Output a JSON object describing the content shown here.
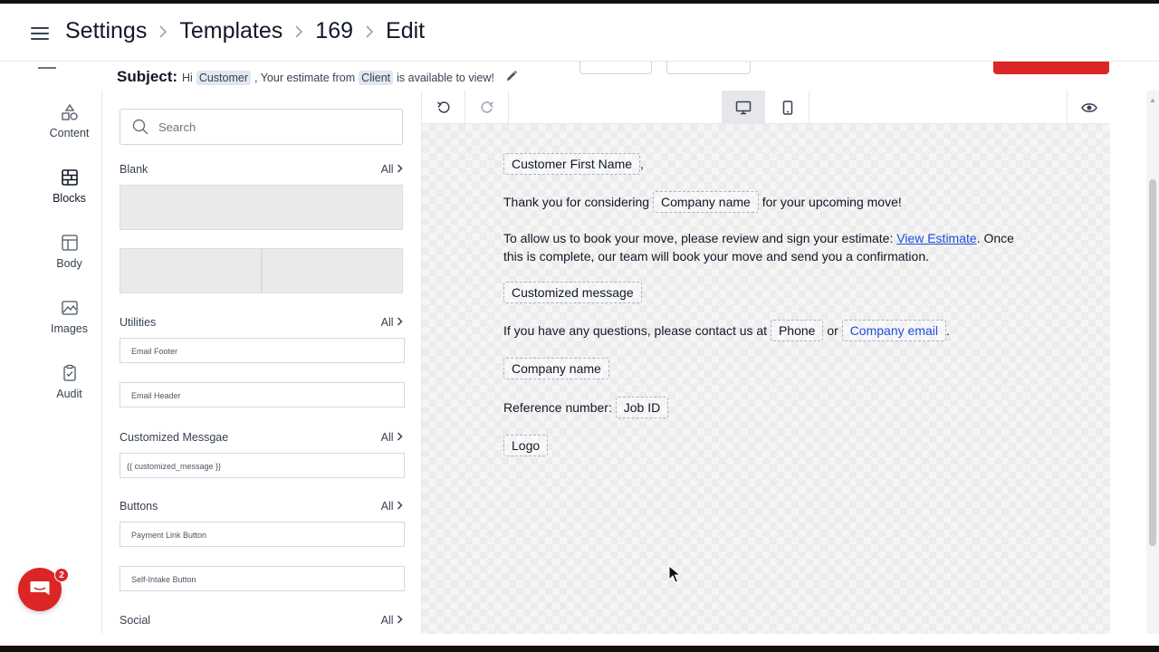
{
  "breadcrumb": [
    "Settings",
    "Templates",
    "169",
    "Edit"
  ],
  "subject": {
    "label": "Subject",
    "colon": ":",
    "prefix": "Hi",
    "tag1": "Customer",
    "middle": ", Your estimate from",
    "tag2": "Client",
    "suffix": "is available to view!"
  },
  "nav": [
    {
      "label": "Content",
      "icon": "shapes-icon"
    },
    {
      "label": "Blocks",
      "icon": "brick-icon"
    },
    {
      "label": "Body",
      "icon": "layout-icon"
    },
    {
      "label": "Images",
      "icon": "image-icon"
    },
    {
      "label": "Audit",
      "icon": "clipboard-check-icon"
    }
  ],
  "panel": {
    "search_placeholder": "Search",
    "all_label": "All",
    "sections": {
      "blank": "Blank",
      "utilities": "Utilities",
      "customized": "Customized Messgae",
      "buttons": "Buttons",
      "social": "Social"
    },
    "utility_items": [
      "Email Footer",
      "Email Header"
    ],
    "customized_items": [
      "{{ customized_message }}"
    ],
    "button_items": [
      "Payment Link Button",
      "Self-Intake Button"
    ]
  },
  "email": {
    "greeting_ph": "Customer First Name",
    "greeting_comma": ",",
    "thanks_pre": "Thank you for considering",
    "thanks_ph": "Company name",
    "thanks_post": "for your upcoming move!",
    "allow_pre": "To allow us to book your move, please review and sign your estimate:",
    "allow_link": "View Estimate",
    "allow_post": ". Once",
    "allow_line2": "this is complete, our team will book your move and send you a confirmation.",
    "custom_ph": "Customized message",
    "contact_pre": "If you have any questions, please contact us at",
    "phone_ph": "Phone",
    "or": "or",
    "email_ph": "Company email",
    "period": ".",
    "company_ph": "Company name",
    "ref_label": "Reference number:",
    "job_ph": "Job ID",
    "logo_ph": "Logo"
  },
  "chat_badge": "2",
  "colors": {
    "accent": "#dc2626",
    "link": "#1d4ed8"
  }
}
